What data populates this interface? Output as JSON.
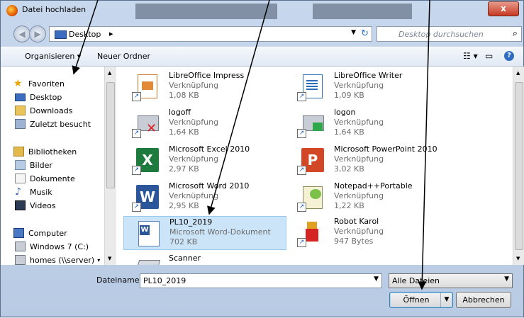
{
  "window": {
    "title": "Datei hochladen",
    "close": "x"
  },
  "nav": {
    "address_crumb": "Desktop",
    "address_sep": "▸",
    "search_placeholder": "Desktop durchsuchen"
  },
  "toolbar": {
    "organize": "Organisieren ▾",
    "new_folder": "Neuer Ordner"
  },
  "sidebar": {
    "favorites": "Favoriten",
    "fav_items": [
      "Desktop",
      "Downloads",
      "Zuletzt besucht"
    ],
    "libraries": "Bibliotheken",
    "lib_items": [
      "Bilder",
      "Dokumente",
      "Musik",
      "Videos"
    ],
    "computer": "Computer",
    "comp_items": [
      "Windows 7 (C:)",
      "homes (\\\\server)"
    ]
  },
  "files": [
    {
      "name": "LibreOffice Impress",
      "type": "Verknüpfung",
      "size": "1,08 KB",
      "icon": "impress-icon"
    },
    {
      "name": "LibreOffice Writer",
      "type": "Verknüpfung",
      "size": "1,09 KB",
      "icon": "writer-icon"
    },
    {
      "name": "logoff",
      "type": "Verknüpfung",
      "size": "1,64 KB",
      "icon": "logoff-icon"
    },
    {
      "name": "logon",
      "type": "Verknüpfung",
      "size": "1,64 KB",
      "icon": "logon-icon"
    },
    {
      "name": "Microsoft Excel 2010",
      "type": "Verknüpfung",
      "size": "2,97 KB",
      "icon": "excel-icon"
    },
    {
      "name": "Microsoft PowerPoint 2010",
      "type": "Verknüpfung",
      "size": "3,02 KB",
      "icon": "powerpoint-icon"
    },
    {
      "name": "Microsoft Word 2010",
      "type": "Verknüpfung",
      "size": "2,95 KB",
      "icon": "word-icon"
    },
    {
      "name": "Notepad++Portable",
      "type": "Verknüpfung",
      "size": "1,22 KB",
      "icon": "notepad-icon"
    },
    {
      "name": "PL10_2019",
      "type": "Microsoft Word-Dokument",
      "size": "702 KB",
      "icon": "word-document-icon",
      "selected": true
    },
    {
      "name": "Robot Karol",
      "type": "Verknüpfung",
      "size": "947 Bytes",
      "icon": "robot-icon"
    },
    {
      "name": "Scanner",
      "type": "",
      "size": "",
      "icon": "scanner-icon"
    }
  ],
  "bottom": {
    "filename_label": "Dateiname:",
    "filename_value": "PL10_2019",
    "filetype_value": "Alle Dateien",
    "open_label": "Öffnen",
    "cancel_label": "Abbrechen"
  },
  "colors": {
    "selection": "#cce4f7",
    "accent": "#3c7fb1"
  }
}
